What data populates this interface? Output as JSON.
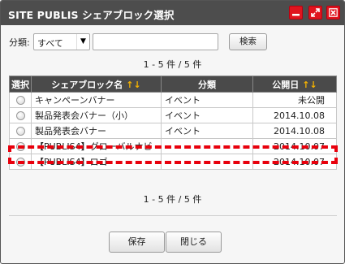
{
  "window": {
    "title": "SITE PUBLIS シェアブロック選択",
    "minimize_icon": "minimize-icon",
    "maximize_icon": "maximize-icon",
    "close_icon": "close-icon",
    "button_color": "#e0141e"
  },
  "filter": {
    "label": "分類:",
    "selected": "すべて",
    "search_value": "",
    "search_button": "検索"
  },
  "pager": {
    "top": "1 - 5 件 / 5 件",
    "bottom": "1 - 5 件 / 5 件"
  },
  "table": {
    "headers": {
      "select": "選択",
      "name": "シェアブロック名",
      "name_sort": "↑↓",
      "category": "分類",
      "date": "公開日",
      "date_sort": "↑↓"
    },
    "rows": [
      {
        "name": "キャンペーンバナー",
        "category": "イベント",
        "date": "未公開",
        "checked": false
      },
      {
        "name": "製品発表会バナー（小）",
        "category": "イベント",
        "date": "2014.10.08",
        "checked": false
      },
      {
        "name": "製品発表会バナー",
        "category": "イベント",
        "date": "2014.10.08",
        "checked": false
      },
      {
        "name": "【PUBLIS4】グローバルナビ",
        "category": "",
        "date": "2014.10.07",
        "checked": true
      },
      {
        "name": "【PUBLIS4】ロゴ",
        "category": "",
        "date": "2014.10.07",
        "checked": false
      }
    ]
  },
  "highlight": {
    "row": 3,
    "color": "#e8000c"
  },
  "buttons": {
    "save": "保存",
    "close": "閉じる"
  }
}
